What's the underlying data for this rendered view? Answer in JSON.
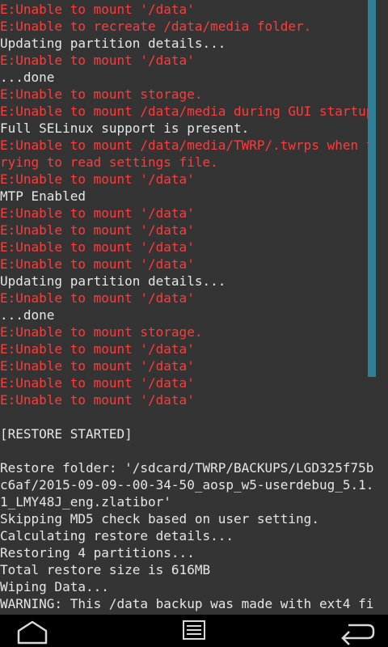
{
  "console": {
    "lines": [
      {
        "text": "E:Unable to mount '/data'",
        "type": "error"
      },
      {
        "text": "E:Unable to recreate /data/media folder.",
        "type": "error"
      },
      {
        "text": "Updating partition details...",
        "type": "normal"
      },
      {
        "text": "E:Unable to mount '/data'",
        "type": "error"
      },
      {
        "text": "...done",
        "type": "normal"
      },
      {
        "text": "E:Unable to mount storage.",
        "type": "error"
      },
      {
        "text": "E:Unable to mount /data/media during GUI startup",
        "type": "error"
      },
      {
        "text": "Full SELinux support is present.",
        "type": "normal"
      },
      {
        "text": "E:Unable to mount /data/media/TWRP/.twrps when t",
        "type": "error"
      },
      {
        "text": "rying to read settings file.",
        "type": "error"
      },
      {
        "text": "E:Unable to mount '/data'",
        "type": "error"
      },
      {
        "text": "MTP Enabled",
        "type": "normal"
      },
      {
        "text": "E:Unable to mount '/data'",
        "type": "error"
      },
      {
        "text": "E:Unable to mount '/data'",
        "type": "error"
      },
      {
        "text": "E:Unable to mount '/data'",
        "type": "error"
      },
      {
        "text": "E:Unable to mount '/data'",
        "type": "error"
      },
      {
        "text": "Updating partition details...",
        "type": "normal"
      },
      {
        "text": "E:Unable to mount '/data'",
        "type": "error"
      },
      {
        "text": "...done",
        "type": "normal"
      },
      {
        "text": "E:Unable to mount storage.",
        "type": "error"
      },
      {
        "text": "E:Unable to mount '/data'",
        "type": "error"
      },
      {
        "text": "E:Unable to mount '/data'",
        "type": "error"
      },
      {
        "text": "E:Unable to mount '/data'",
        "type": "error"
      },
      {
        "text": "E:Unable to mount '/data'",
        "type": "error"
      },
      {
        "text": "",
        "type": "normal"
      },
      {
        "text": "[RESTORE STARTED]",
        "type": "normal"
      },
      {
        "text": "",
        "type": "normal"
      },
      {
        "text": "Restore folder: '/sdcard/TWRP/BACKUPS/LGD325f75b",
        "type": "normal"
      },
      {
        "text": "c6af/2015-09-09--00-34-50_aosp_w5-userdebug_5.1.",
        "type": "normal"
      },
      {
        "text": "1_LMY48J_eng.zlatibor'",
        "type": "normal"
      },
      {
        "text": "Skipping MD5 check based on user setting.",
        "type": "normal"
      },
      {
        "text": "Calculating restore details...",
        "type": "normal"
      },
      {
        "text": "Restoring 4 partitions...",
        "type": "normal"
      },
      {
        "text": "Total restore size is 616MB",
        "type": "normal"
      },
      {
        "text": "Wiping Data...",
        "type": "normal"
      },
      {
        "text": "WARNING: This /data backup was made with ext4 fi",
        "type": "normal"
      }
    ]
  },
  "navbar": {
    "home_icon": "home-icon",
    "menu_icon": "console-menu-icon",
    "back_icon": "back-icon"
  },
  "colors": {
    "background": "#343434",
    "error_text": "#ff3b3b",
    "normal_text": "#e6e6e6",
    "scrollbar": "#2f7f96",
    "navbar": "#000000"
  }
}
